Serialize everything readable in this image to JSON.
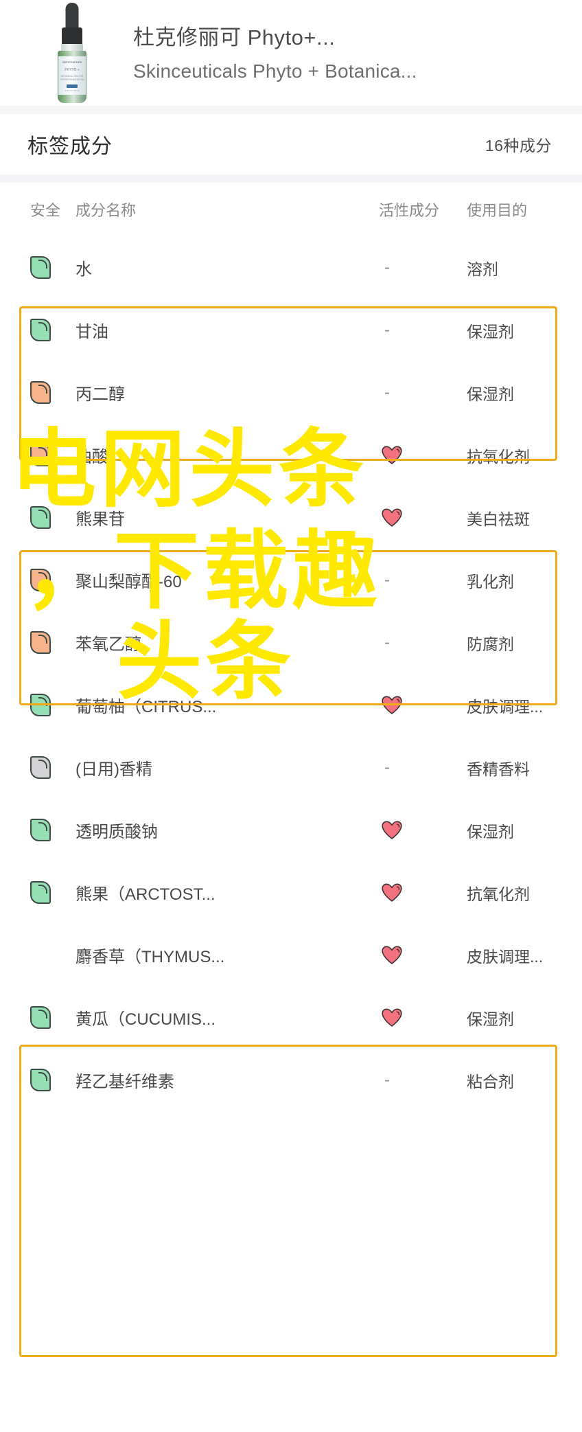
{
  "product": {
    "title_cn": "杜克修丽可 Phyto+...",
    "title_en": "Skinceuticals Phyto + Botanica...",
    "image_name": "product-bottle-thumbnail",
    "bottle_label": {
      "brand": "SkinCeuticals",
      "name": "PHYTO +",
      "sub": "BOTANICAL GEL FOR\nHYPERPIGMENTATION",
      "volume": "1.0 fl oz / 30 ml"
    }
  },
  "section": {
    "title": "标签成分",
    "count": "16种成分"
  },
  "columns": {
    "safety": "安全",
    "name": "成分名称",
    "active": "活性成分",
    "purpose": "使用目的"
  },
  "rows": [
    {
      "safety": "green",
      "name": "水",
      "active": "-",
      "purpose": "溶剂"
    },
    {
      "safety": "green",
      "name": "甘油",
      "active": "-",
      "purpose": "保湿剂"
    },
    {
      "safety": "orange",
      "name": "丙二醇",
      "active": "-",
      "purpose": "保湿剂"
    },
    {
      "safety": "orange",
      "name": "曲酸",
      "active": "heart",
      "purpose": "抗氧化剂"
    },
    {
      "safety": "green",
      "name": "熊果苷",
      "active": "heart",
      "purpose": "美白祛斑"
    },
    {
      "safety": "orange",
      "name": "聚山梨醇酯-60",
      "active": "-",
      "purpose": "乳化剂"
    },
    {
      "safety": "orange",
      "name": "苯氧乙醇",
      "active": "-",
      "purpose": "防腐剂"
    },
    {
      "safety": "green",
      "name": "葡萄柚（CITRUS...",
      "active": "heart",
      "purpose": "皮肤调理..."
    },
    {
      "safety": "gray",
      "name": "(日用)香精",
      "active": "-",
      "purpose": "香精香料"
    },
    {
      "safety": "green",
      "name": "透明质酸钠",
      "active": "heart",
      "purpose": "保湿剂"
    },
    {
      "safety": "green",
      "name": "熊果（ARCTOST...",
      "active": "heart",
      "purpose": "抗氧化剂"
    },
    {
      "safety": "none",
      "name": "麝香草（THYMUS...",
      "active": "heart",
      "purpose": "皮肤调理..."
    },
    {
      "safety": "green",
      "name": "黄瓜（CUCUMIS...",
      "active": "heart",
      "purpose": "保湿剂"
    },
    {
      "safety": "green",
      "name": "羟乙基纤维素",
      "active": "-",
      "purpose": "粘合剂"
    }
  ],
  "watermark": {
    "line1": "电网头条",
    "line2": "，下载趣",
    "line3": "头条"
  },
  "colors": {
    "highlight_border": "#f0ab1a",
    "safety_green": "#96dfb4",
    "safety_orange": "#f7b48c",
    "safety_gray": "#d4d4d6",
    "heart": "#f4717f",
    "watermark": "#ffe900"
  }
}
